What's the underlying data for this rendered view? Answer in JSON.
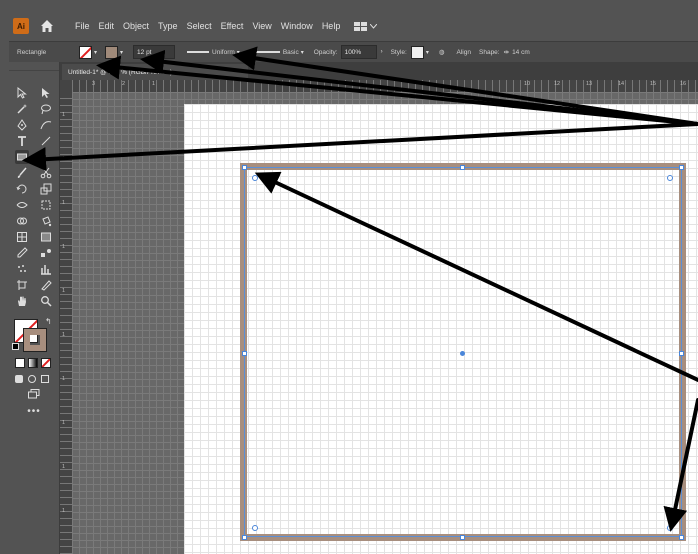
{
  "menu": {
    "logo": "Ai",
    "items": [
      "File",
      "Edit",
      "Object",
      "Type",
      "Select",
      "Effect",
      "View",
      "Window",
      "Help"
    ]
  },
  "control_bar": {
    "tool_label": "Rectangle",
    "stroke_weight": "12 pt",
    "profile_label": "Uniform",
    "brush_label": "Basic",
    "opacity_label": "Opacity:",
    "opacity_value": "100%",
    "style_label": "Style:",
    "align_label": "Align",
    "shape_label": "Shape:",
    "width_value": "14 cm"
  },
  "document": {
    "tab_title": "Untitled-1* @ 100 % (RGB/Preview)"
  },
  "rulers": {
    "top": [
      "3",
      "2",
      "1",
      "",
      "1",
      "2",
      "3",
      "4",
      "5",
      "6",
      "7",
      "8",
      "9",
      "10",
      "11",
      "12",
      "13",
      "14",
      "15",
      "16"
    ],
    "left": [
      "1",
      "1",
      "1",
      "1",
      "1",
      "1",
      "1",
      "1",
      "1",
      "1"
    ]
  },
  "colors": {
    "stroke": "#a78e7e",
    "fill": "none",
    "selection": "#4a86d9",
    "accent": "#cf6c18"
  },
  "icons": {
    "home": "home-icon",
    "workspace": "workspace-switcher-icon",
    "rectangle_tool": "rectangle-tool-icon"
  }
}
